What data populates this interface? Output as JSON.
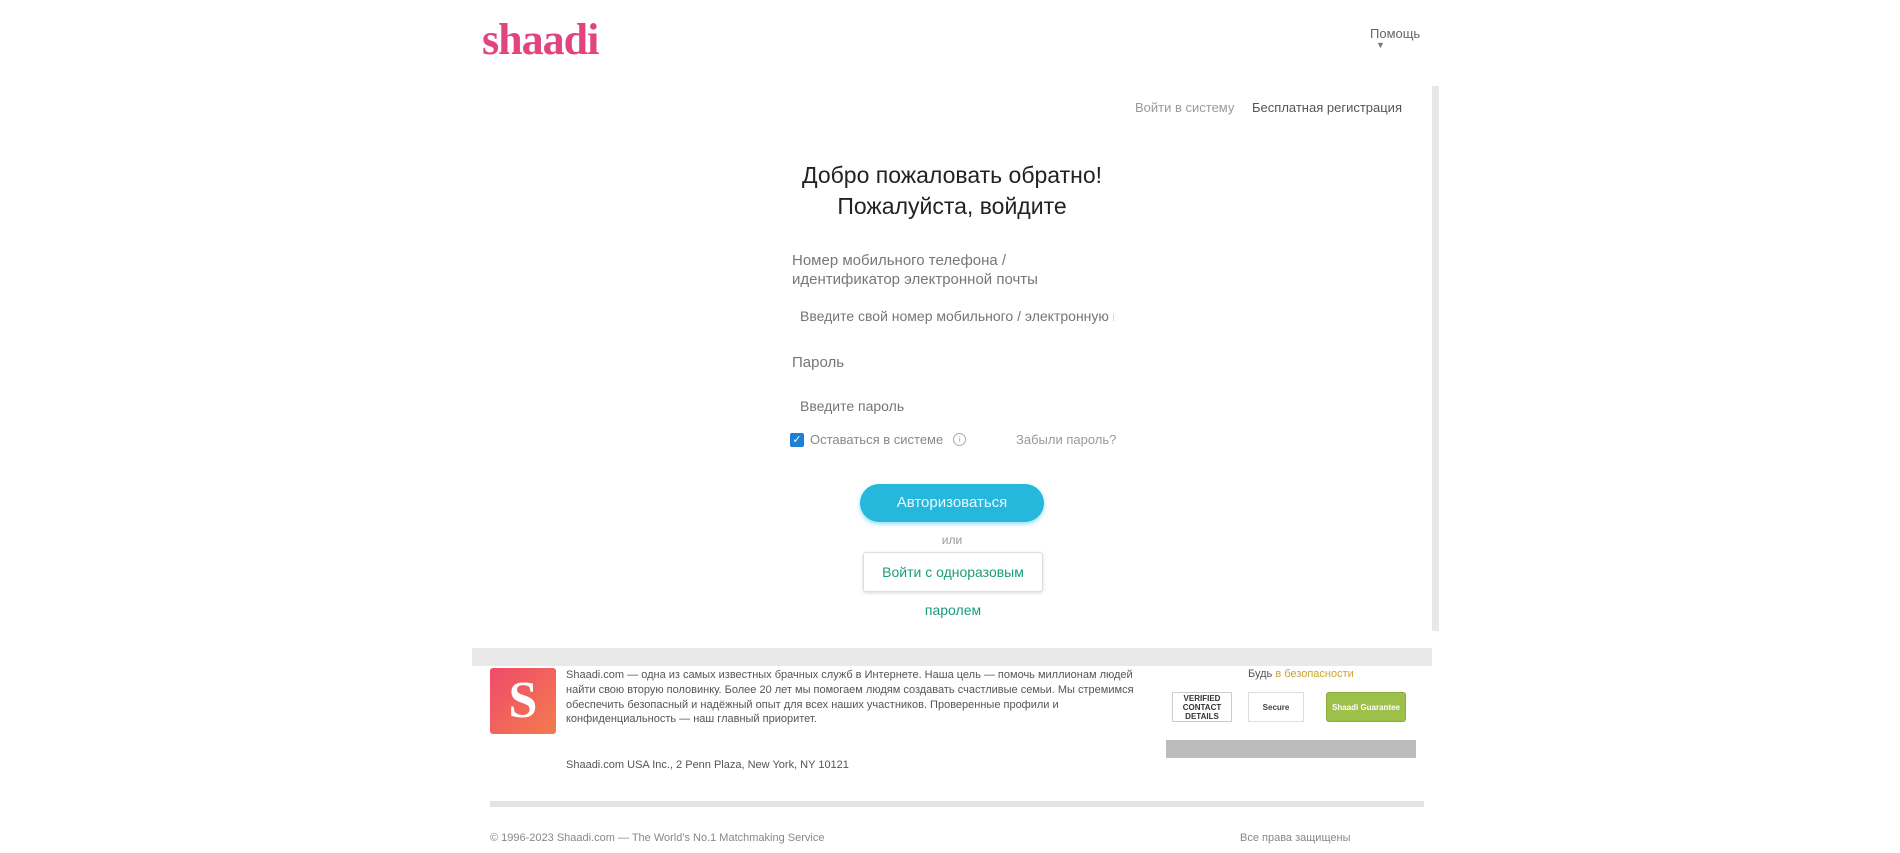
{
  "header": {
    "logo": "shaadi",
    "help": "Помощь"
  },
  "card": {
    "top_links": {
      "login": "Войти в систему",
      "register": "Бесплатная регистрация"
    },
    "title_line1": "Добро пожаловать обратно!",
    "title_line2": "Пожалуйста, войдите",
    "phone_label": "Номер мобильного телефона / идентификатор электронной почты",
    "phone_placeholder": "Введите свой номер мобильного / электронную почту",
    "password_label": "Пароль",
    "password_placeholder": "Введите пароль",
    "remember_label": "Оставаться в системе",
    "forgot_label": "Забыли пароль?",
    "login_button": "Авторизоваться",
    "or_label": "или",
    "otp_button": "Войти с одноразовым паролем"
  },
  "footer": {
    "s_logo": "S",
    "about_text": "Shaadi.com — одна из самых известных брачных служб в Интернете. Наша цель — помочь миллионам людей найти свою вторую половинку. Более 20 лет мы помогаем людям создавать счастливые семьи. Мы стремимся обеспечить безопасный и надёжный опыт для всех наших участников. Проверенные профили и конфиденциальность — наш главный приоритет.",
    "address": "Shaadi.com USA Inc., 2 Penn Plaza, New York, NY 10121",
    "trust_title": "Будь",
    "trust_highlight": "в безопасности",
    "badges": {
      "verified": "VERIFIED CONTACT DETAILS",
      "secure": "Secure",
      "guarantee": "Shaadi Guarantee"
    },
    "copyright": "© 1996-2023 Shaadi.com — The World's No.1 Matchmaking Service",
    "footer_right": "Все права защищены"
  },
  "colors": {
    "brand": "#e2457e",
    "login_button": "#26b7dc",
    "otp_text": "#1a9c7a",
    "checkbox": "#1d7fd6"
  }
}
